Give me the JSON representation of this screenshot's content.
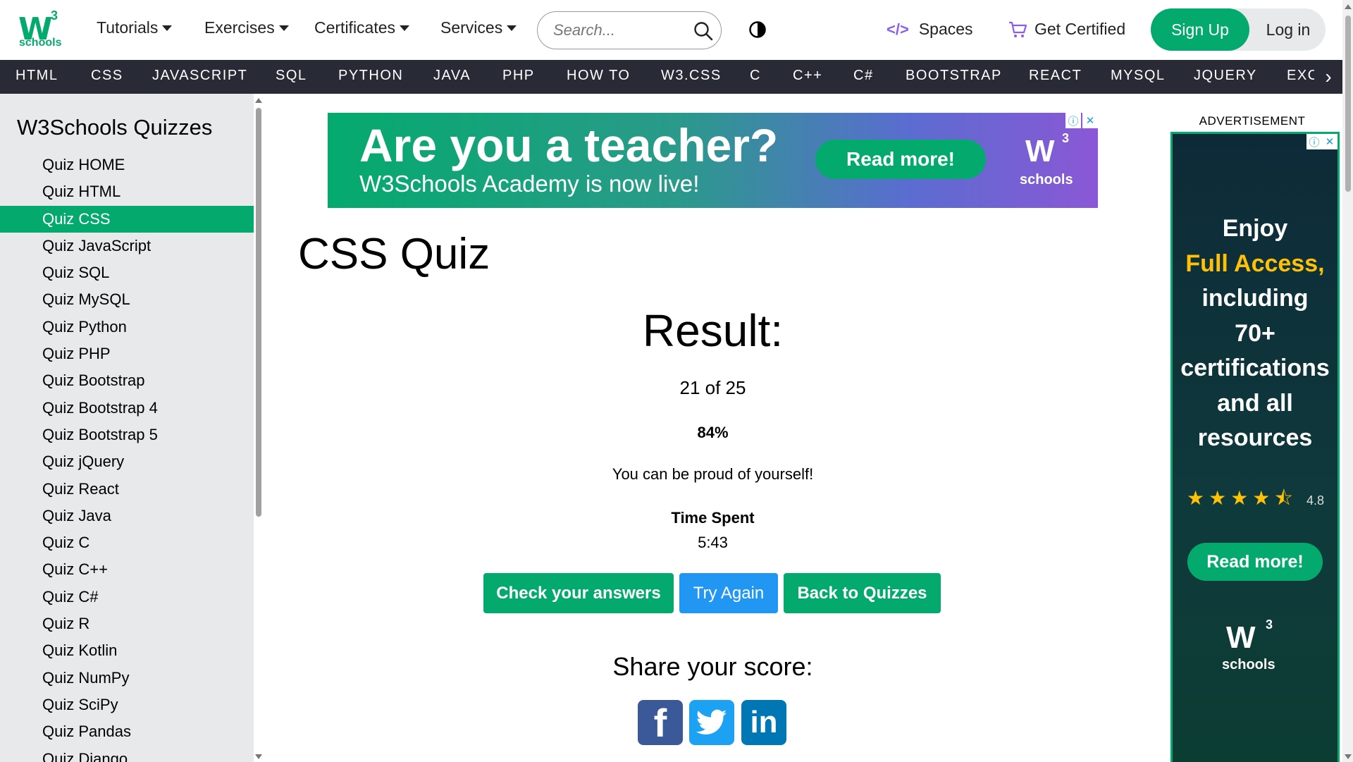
{
  "header": {
    "logo": {
      "mark": "W",
      "superscript": "3",
      "wordmark": "schools"
    },
    "nav": [
      {
        "label": "Tutorials"
      },
      {
        "label": "Exercises"
      },
      {
        "label": "Certificates"
      },
      {
        "label": "Services"
      }
    ],
    "search": {
      "placeholder": "Search..."
    },
    "spaces_label": "Spaces",
    "spaces_icon": "</>",
    "certified_label": "Get Certified",
    "signup_label": "Sign Up",
    "login_label": "Log in",
    "accent_color": "#04AA6D"
  },
  "topics": [
    "HTML",
    "CSS",
    "JAVASCRIPT",
    "SQL",
    "PYTHON",
    "JAVA",
    "PHP",
    "HOW TO",
    "W3.CSS",
    "C",
    "C++",
    "C#",
    "BOOTSTRAP",
    "REACT",
    "MYSQL",
    "JQUERY",
    "EXC"
  ],
  "topics_arrow": "›",
  "sidebar": {
    "title": "W3Schools Quizzes",
    "items": [
      "Quiz HOME",
      "Quiz HTML",
      "Quiz CSS",
      "Quiz JavaScript",
      "Quiz SQL",
      "Quiz MySQL",
      "Quiz Python",
      "Quiz PHP",
      "Quiz Bootstrap",
      "Quiz Bootstrap 4",
      "Quiz Bootstrap 5",
      "Quiz jQuery",
      "Quiz React",
      "Quiz Java",
      "Quiz C",
      "Quiz C++",
      "Quiz C#",
      "Quiz R",
      "Quiz Kotlin",
      "Quiz NumPy",
      "Quiz SciPy",
      "Quiz Pandas",
      "Quiz Django"
    ],
    "active": "Quiz CSS"
  },
  "banner": {
    "headline": "Are you a teacher?",
    "subline": "W3Schools Academy is now live!",
    "button": "Read more!",
    "logo_mark": "W",
    "logo_super": "3",
    "logo_word": "schools",
    "ad_info": "ⓘ",
    "ad_close": "✕"
  },
  "main": {
    "title": "CSS Quiz",
    "result_label": "Result:",
    "score": "21 of 25",
    "percent": "84%",
    "message": "You can be proud of yourself!",
    "time_label": "Time Spent",
    "time_value": "5:43",
    "buttons": {
      "check": "Check your answers",
      "retry": "Try Again",
      "back": "Back to Quizzes"
    },
    "share_label": "Share your score:",
    "social": [
      {
        "name": "facebook-icon",
        "glyph": "f",
        "color": "#3B5998"
      },
      {
        "name": "twitter-icon",
        "glyph": "t",
        "color": "#1DA1F2"
      },
      {
        "name": "linkedin-icon",
        "glyph": "in",
        "color": "#0077B5"
      }
    ]
  },
  "side_ad": {
    "label": "ADVERTISEMENT",
    "line1": "Enjoy",
    "line2": "Full Access,",
    "line3": "including",
    "line4": "70+",
    "line5": "certifications",
    "line6": "and all",
    "line7": "resources",
    "stars": "★★★★⯪",
    "rating": "4.8",
    "button": "Read more!",
    "logo_mark": "W",
    "logo_super": "3",
    "logo_word": "schools",
    "ad_info": "ⓘ",
    "ad_close": "✕"
  }
}
